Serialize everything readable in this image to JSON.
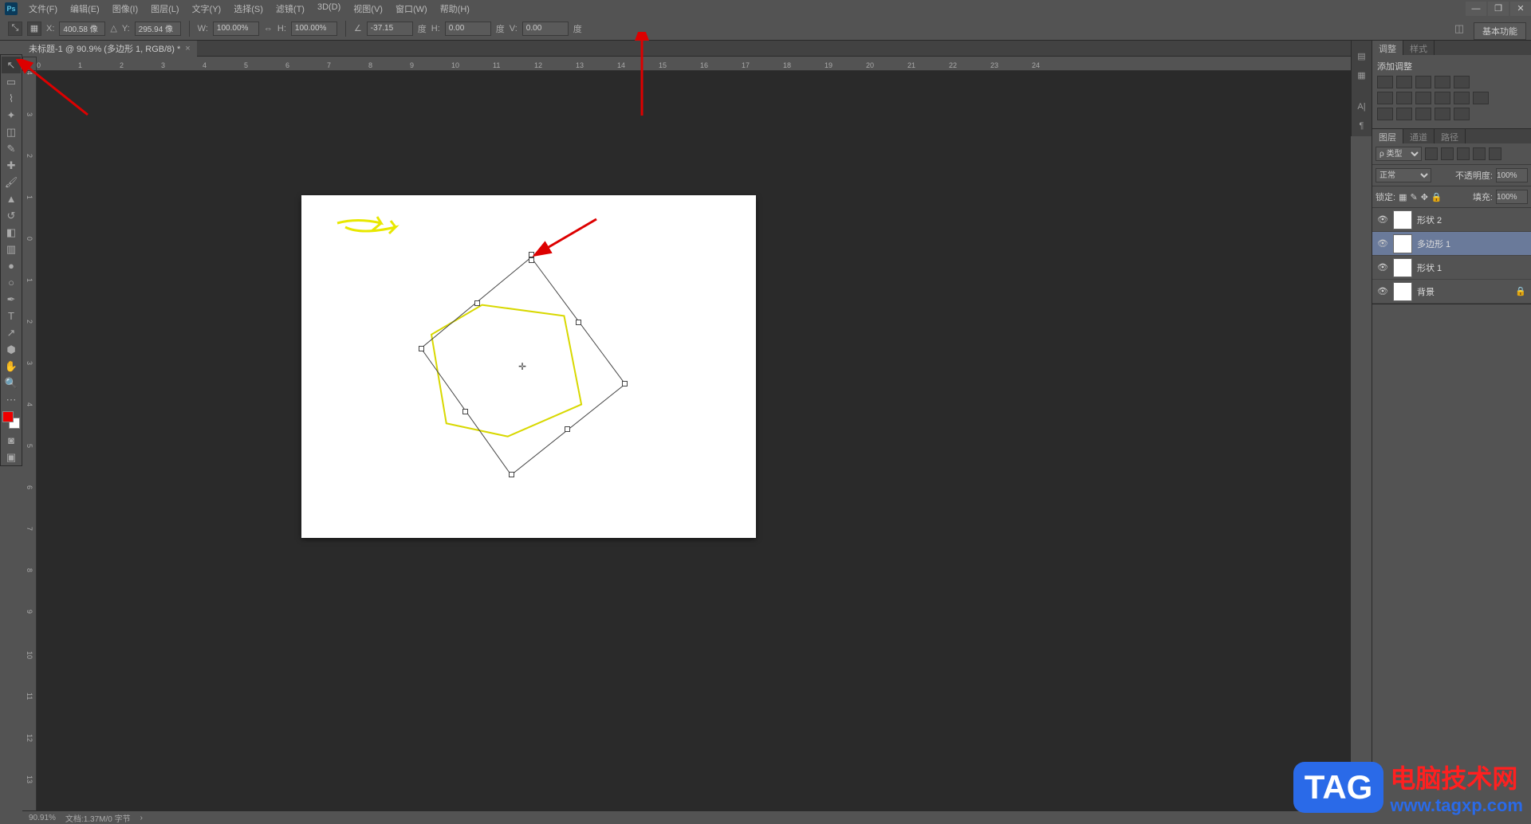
{
  "app": {
    "logo": "Ps"
  },
  "menu": [
    "文件(F)",
    "编辑(E)",
    "图像(I)",
    "图层(L)",
    "文字(Y)",
    "选择(S)",
    "滤镜(T)",
    "3D(D)",
    "视图(V)",
    "窗口(W)",
    "帮助(H)"
  ],
  "options": {
    "x_label": "X:",
    "x": "400.58 像",
    "y_label": "Y:",
    "y": "295.94 像",
    "w_label": "W:",
    "w": "100.00%",
    "h_label": "H:",
    "h": "100.00%",
    "angle_label": "",
    "angle": "-37.15",
    "deg1": "度",
    "hskew_label": "H:",
    "hskew": "0.00",
    "deg2": "度",
    "vskew_label": "V:",
    "vskew": "0.00",
    "deg3": "度"
  },
  "workspace_label": "基本功能",
  "tab": {
    "title": "未标题-1 @ 90.9% (多边形 1, RGB/8) *"
  },
  "ruler_h": [
    "12",
    "11",
    "10",
    "9",
    "8",
    "9",
    "10",
    "11",
    "12",
    "13",
    "14",
    "15",
    "16",
    "17",
    "18",
    "19",
    "20",
    "21",
    "22",
    "23",
    "24"
  ],
  "ruler_h_real": [
    0,
    1,
    2,
    3,
    4,
    5,
    6,
    7,
    8,
    9,
    10,
    11,
    12,
    13,
    14,
    15,
    16,
    17,
    18,
    19,
    20,
    21,
    22,
    23,
    24
  ],
  "ruler_v": [
    4,
    3,
    2,
    1,
    0,
    1,
    2,
    3,
    4,
    5,
    6,
    7,
    8,
    9,
    10,
    11,
    12,
    13
  ],
  "adjustments": {
    "tab": "调整",
    "tab2": "样式",
    "label": "添加调整"
  },
  "layers_panel": {
    "tab1": "图层",
    "tab2": "通道",
    "tab3": "路径",
    "kind": "ρ 类型",
    "blend": "正常",
    "opacity_label": "不透明度:",
    "opacity": "100%",
    "lock_label": "锁定: ",
    "fill_label": "填充:",
    "fill": "100%"
  },
  "layers": [
    {
      "name": "形状 2"
    },
    {
      "name": "多边形 1"
    },
    {
      "name": "形状 1"
    },
    {
      "name": "背景"
    }
  ],
  "status": {
    "zoom": "90.91%",
    "doc": "文档:1.37M/0 字节"
  },
  "watermark": {
    "badge": "TAG",
    "cn": "电脑技术网",
    "url": "www.tagxp.com"
  }
}
